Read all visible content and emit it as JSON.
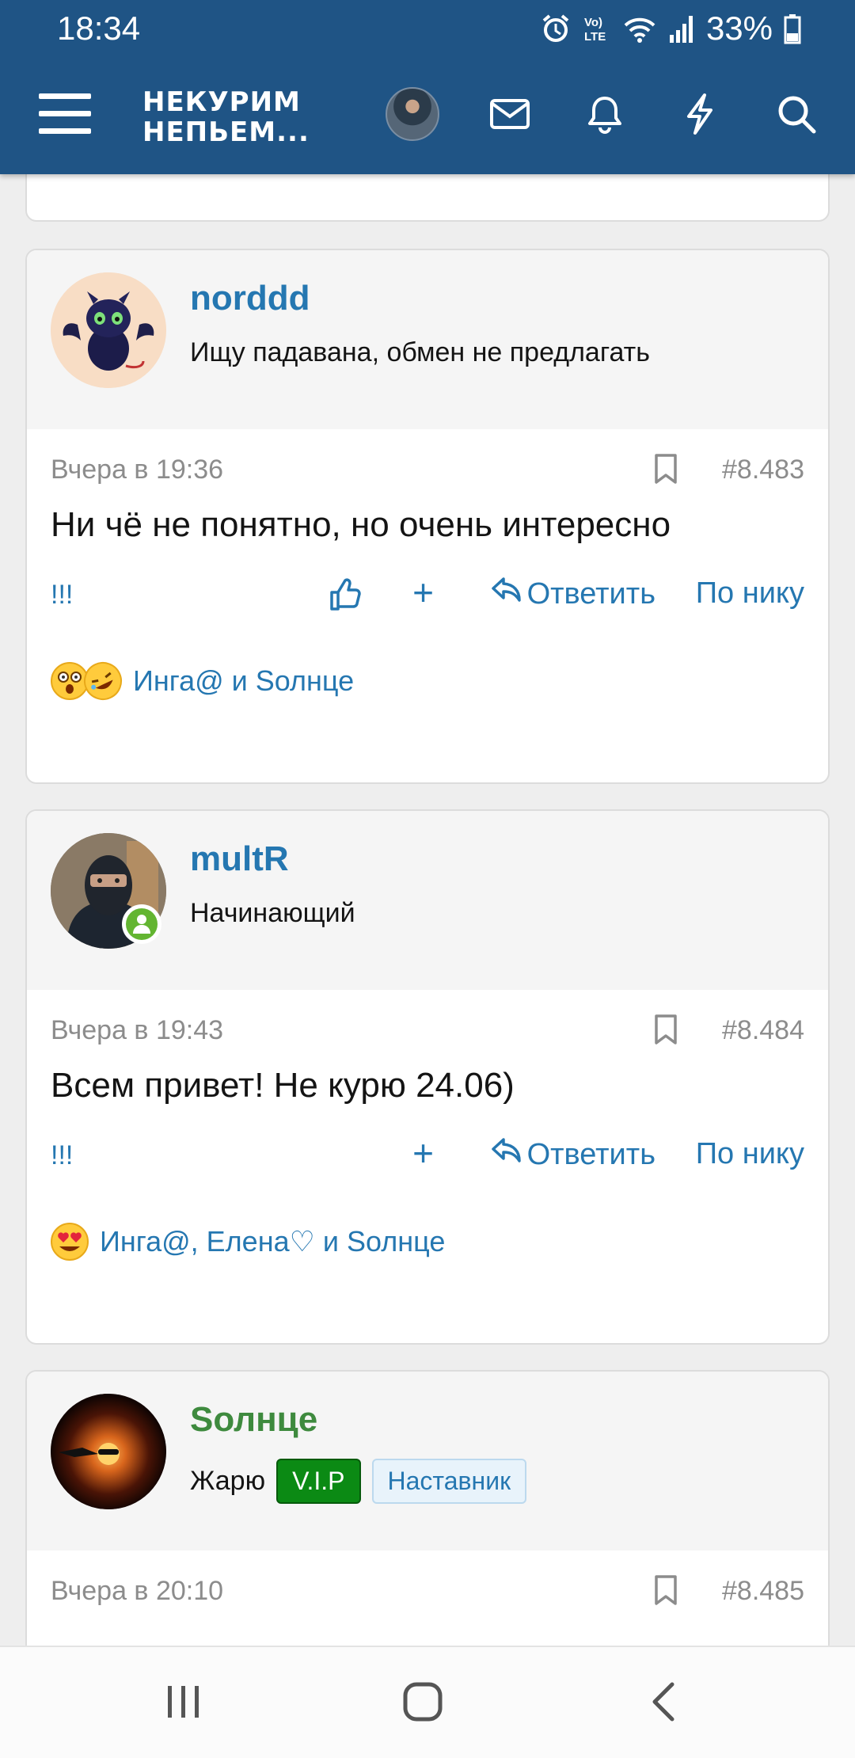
{
  "status": {
    "time": "18:34",
    "battery": "33%"
  },
  "header": {
    "brand_line1": "НЕКУРИМ",
    "brand_line2": "НЕПЬЕМ..."
  },
  "posts": [
    {
      "username": "norddd",
      "user_title": "Ищу падавана, обмен не предлагать",
      "date": "Вчера в 19:36",
      "number": "#8.483",
      "message": "Ни чё не понятно, но очень интересно",
      "reactions_text": "Инга@ и Sолнце"
    },
    {
      "username": "multR",
      "user_title": "Начинающий",
      "date": "Вчера в 19:43",
      "number": "#8.484",
      "message": "Всем привет! Не курю 24.06)",
      "reactions_text": "Инга@, Елена♡ и Sолнце"
    },
    {
      "username": "Sолнце",
      "user_title": "Жарю",
      "badge_vip": "V.I.P",
      "badge_mentor": "Наставник",
      "date": "Вчера в 20:10",
      "number": "#8.485"
    }
  ],
  "actions": {
    "bang": "!!!",
    "plus": "+",
    "reply": "Ответить",
    "by_nick": "По нику"
  },
  "colors": {
    "header": "#1f5485",
    "link": "#2577b1",
    "vip": "#0b8a14",
    "online": "#63b531"
  }
}
